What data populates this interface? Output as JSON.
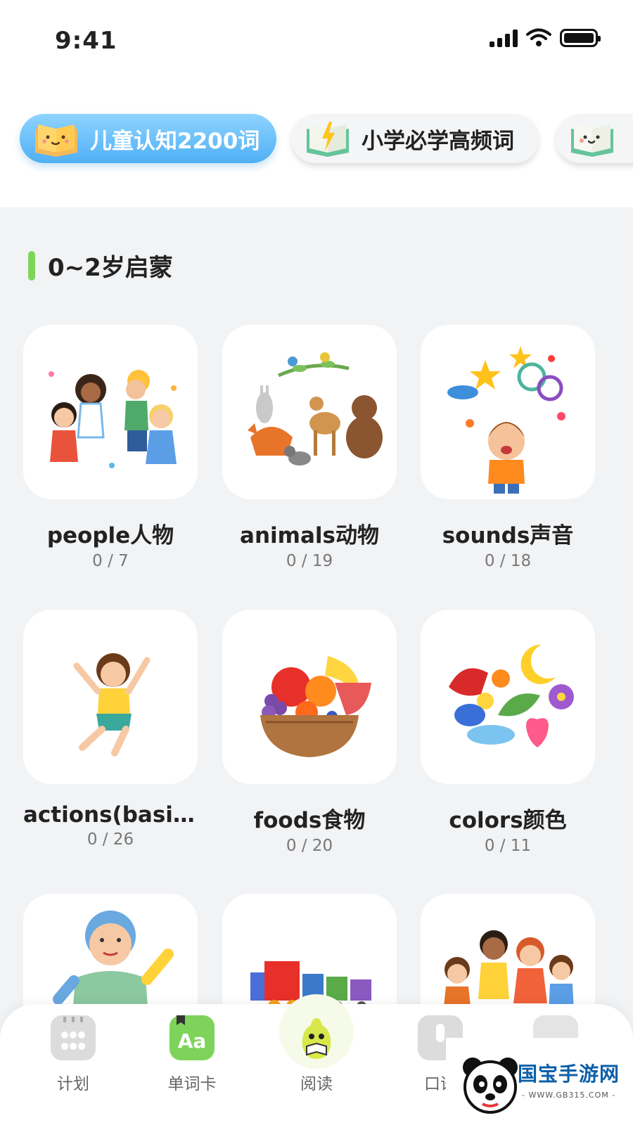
{
  "status_bar": {
    "time": "9:41"
  },
  "categories": {
    "active": {
      "label": "儿童认知2200词",
      "icon": "smiling-book-icon",
      "color": "#4fb0f5"
    },
    "second": {
      "label": "小学必学高频词",
      "icon": "lightning-book-icon"
    },
    "third": {
      "label": "",
      "icon": "smiling-book-icon"
    }
  },
  "section": {
    "title": "0~2岁启蒙",
    "accent": "#7dd65a"
  },
  "cards": [
    {
      "title": "people人物",
      "progress": "0 / 7",
      "icon": "children-playing-image"
    },
    {
      "title": "animals动物",
      "progress": "0 / 19",
      "icon": "forest-animals-image"
    },
    {
      "title": "sounds声音",
      "progress": "0 / 18",
      "icon": "boy-sounds-image"
    },
    {
      "title": "actions(basic)...",
      "progress": "0 / 26",
      "icon": "jumping-girl-image"
    },
    {
      "title": "foods食物",
      "progress": "0 / 20",
      "icon": "fruit-bowl-image"
    },
    {
      "title": "colors颜色",
      "progress": "0 / 11",
      "icon": "colorful-objects-image"
    },
    {
      "title": "",
      "progress": "",
      "icon": "boy-waving-image"
    },
    {
      "title": "",
      "progress": "",
      "icon": "toy-train-image"
    },
    {
      "title": "",
      "progress": "",
      "icon": "kids-group-image"
    }
  ],
  "bottom_nav": [
    {
      "label": "计划",
      "icon": "calendar-icon"
    },
    {
      "label": "单词卡",
      "icon": "word-card-icon"
    },
    {
      "label": "阅读",
      "icon": "pear-reading-icon"
    },
    {
      "label": "口语",
      "icon": "microphone-icon"
    },
    {
      "label": "",
      "icon": "profile-icon"
    }
  ],
  "watermark": {
    "text": "国宝手游网",
    "sub": "- WWW.GB315.COM -",
    "icon": "panda-logo-icon"
  }
}
